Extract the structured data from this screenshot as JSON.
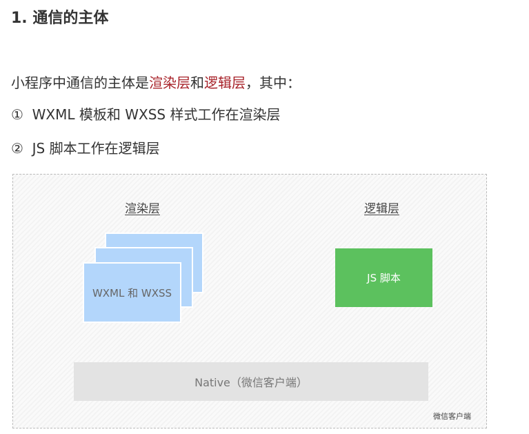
{
  "title": "1. 通信的主体",
  "intro": {
    "prefix": "小程序中通信的主体是",
    "render": "渲染层",
    "and": "和",
    "logic": "逻辑层",
    "suffix": "，其中："
  },
  "items": [
    "①  WXML 模板和 WXSS 样式工作在渲染层",
    "②  JS 脚本工作在逻辑层"
  ],
  "highlight_color": "#a8232a",
  "diagram": {
    "render_label": "渲染层",
    "logic_label": "逻辑层",
    "render_card": "WXML 和 WXSS",
    "logic_card": "JS 脚本",
    "native": "Native（微信客户端）",
    "client_label": "微信客户端",
    "colors": {
      "render": "#b3d6fb",
      "logic": "#5cc15e",
      "native": "#e3e3e3"
    }
  }
}
